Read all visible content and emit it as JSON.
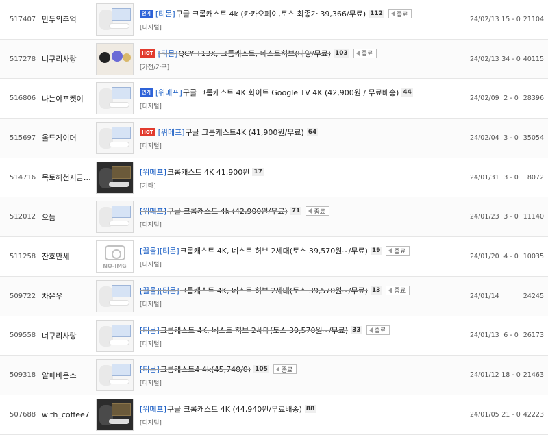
{
  "colors": {
    "shop_link": "#1a5ec4",
    "badge_hot": "#e23b2e",
    "badge_popular": "#2e63d8",
    "ended_text": "#9a9a9a"
  },
  "rows": [
    {
      "id": "517407",
      "writer": "만두의추억",
      "badge": "인기",
      "badge_type": "pop",
      "shop": "[티몬]",
      "title": "구글 크롬캐스트 4k (카카오페이,토스 최종가 39,366/무료)",
      "comments": "112",
      "ended": true,
      "ended_label": "종료",
      "category": "[디지털]",
      "date": "24/02/13",
      "votes": "15 - 0",
      "views": "21104",
      "thumb": "device"
    },
    {
      "id": "517278",
      "writer": "너구리사랑",
      "badge": "HOT",
      "badge_type": "hot",
      "shop": "[티몬]",
      "title": "QCY T13X, 크롬캐스트, 네스트허브(다양/무료)",
      "comments": "103",
      "ended": true,
      "ended_label": "종료",
      "category": "[가전/가구]",
      "date": "24/02/13",
      "votes": "34 - 0",
      "views": "40115",
      "thumb": "speaker"
    },
    {
      "id": "516806",
      "writer": "나는야포켓이",
      "badge": "인기",
      "badge_type": "pop",
      "shop": "[위메프]",
      "title": "구글 크롬캐스트 4K 화이트 Google TV 4K (42,900원 / 무료배송)",
      "comments": "44",
      "ended": false,
      "ended_label": "",
      "category": "[디지털]",
      "date": "24/02/09",
      "votes": "2 - 0",
      "views": "28396",
      "thumb": "device"
    },
    {
      "id": "515697",
      "writer": "올드게이머",
      "badge": "HOT",
      "badge_type": "hot",
      "shop": "[위메프]",
      "title": "구글 크롬캐스트4K (41,900원/무료)",
      "comments": "64",
      "ended": false,
      "ended_label": "",
      "category": "[디지털]",
      "date": "24/02/04",
      "votes": "3 - 0",
      "views": "35054",
      "thumb": "device"
    },
    {
      "id": "514716",
      "writer": "목토해천지금…",
      "badge": "",
      "badge_type": "",
      "shop": "[위메프]",
      "title": "크롬캐스트 4K 41,900원",
      "comments": "17",
      "ended": false,
      "ended_label": "",
      "category": "[기타]",
      "date": "24/01/31",
      "votes": "3 - 0",
      "views": "8072",
      "thumb": "dark"
    },
    {
      "id": "512012",
      "writer": "으늠",
      "badge": "",
      "badge_type": "",
      "shop": "[위메프]",
      "title": "구글 크롬캐스트 4k (42,900원/무료)",
      "comments": "71",
      "ended": true,
      "ended_label": "종료",
      "category": "[디지털]",
      "date": "24/01/23",
      "votes": "3 - 0",
      "views": "11140",
      "thumb": "device"
    },
    {
      "id": "511258",
      "writer": "찬호만세",
      "badge": "",
      "badge_type": "",
      "shop": "[끌올][티몬]",
      "title": "크롬캐스트 4K, 네스트 허브 2세대(토스 39,570원~/무료)",
      "comments": "19",
      "ended": true,
      "ended_label": "종료",
      "category": "[디지털]",
      "date": "24/01/20",
      "votes": "4 - 0",
      "views": "10035",
      "thumb": "noimg"
    },
    {
      "id": "509722",
      "writer": "차은우",
      "badge": "",
      "badge_type": "",
      "shop": "[끌올][티몬]",
      "title": "크롬캐스트 4K, 네스트 허브 2세대(토스 39,570원~/무료)",
      "comments": "13",
      "ended": true,
      "ended_label": "종료",
      "category": "[디지털]",
      "date": "24/01/14",
      "votes": "",
      "views": "24245",
      "thumb": "device"
    },
    {
      "id": "509558",
      "writer": "너구리사랑",
      "badge": "",
      "badge_type": "",
      "shop": "[티몬]",
      "title": "크롬캐스트 4K, 네스트 허브 2세대(토스 39,570원~/무료)",
      "comments": "33",
      "ended": true,
      "ended_label": "종료",
      "category": "[디지털]",
      "date": "24/01/13",
      "votes": "6 - 0",
      "views": "26173",
      "thumb": "device"
    },
    {
      "id": "509318",
      "writer": "알파바운스",
      "badge": "",
      "badge_type": "",
      "shop": "[티몬]",
      "title": "크롬캐스트4 4k(45,740/0)",
      "comments": "105",
      "ended": true,
      "ended_label": "종료",
      "category": "[디지털]",
      "date": "24/01/12",
      "votes": "18 - 0",
      "views": "21463",
      "thumb": "device"
    },
    {
      "id": "507688",
      "writer": "with_coffee7",
      "badge": "",
      "badge_type": "",
      "shop": "[위메프]",
      "title": "구글 크롬캐스트 4K (44,940원/무료배송)",
      "comments": "88",
      "ended": false,
      "ended_label": "",
      "category": "[디지털]",
      "date": "24/01/05",
      "votes": "21 - 0",
      "views": "42223",
      "thumb": "dark"
    }
  ],
  "noimg_label": "NO-IMG"
}
